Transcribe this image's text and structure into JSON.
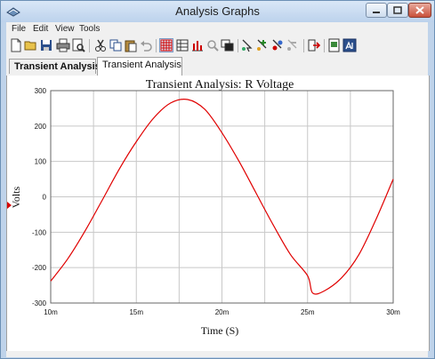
{
  "window": {
    "title": "Analysis Graphs"
  },
  "menu": [
    "File",
    "Edit",
    "View",
    "Tools"
  ],
  "toolbar_icons": [
    "new-icon",
    "open-icon",
    "save-icon",
    "print-icon",
    "print-preview-icon",
    "cut-icon",
    "copy-icon",
    "paste-icon",
    "undo-icon",
    "grid-icon",
    "table-icon",
    "bar-chart-icon",
    "zoom-icon",
    "copy-window-icon",
    "cursor-icon",
    "cursor-add-icon",
    "cursor-color-icon",
    "cursor-remove-icon",
    "export-icon",
    "report-icon",
    "image-icon"
  ],
  "tabs": [
    {
      "label": "Transient Analysis",
      "active": false
    },
    {
      "label": "Transient Analysis",
      "active": true
    }
  ],
  "colors": {
    "trace": "#e00000",
    "grid": "#c8c8c8",
    "marker": "#d60000"
  },
  "chart_data": {
    "type": "line",
    "title": "Transient Analysis: R Voltage",
    "xlabel": "Time (S)",
    "ylabel": "Volts",
    "xlim": [
      0.01,
      0.03
    ],
    "ylim": [
      -300,
      300
    ],
    "x_ticks": [
      "10m",
      "15m",
      "20m",
      "25m",
      "30m"
    ],
    "y_ticks": [
      "300",
      "200",
      "100",
      "0",
      "-100",
      "-200",
      "-300"
    ],
    "grid": true,
    "series": [
      {
        "x": [
          0.01,
          0.011,
          0.012,
          0.013,
          0.014,
          0.015,
          0.016,
          0.017,
          0.018,
          0.019,
          0.02,
          0.021,
          0.022,
          0.023,
          0.024,
          0.025,
          0.0253,
          0.026,
          0.027,
          0.028,
          0.029,
          0.03
        ],
        "y": [
          -238,
          -175,
          -97,
          -10,
          78,
          156,
          222,
          265,
          275,
          247,
          181,
          100,
          10,
          -80,
          -163,
          -223,
          -272,
          -265,
          -228,
          -163,
          -63,
          50
        ]
      }
    ]
  }
}
